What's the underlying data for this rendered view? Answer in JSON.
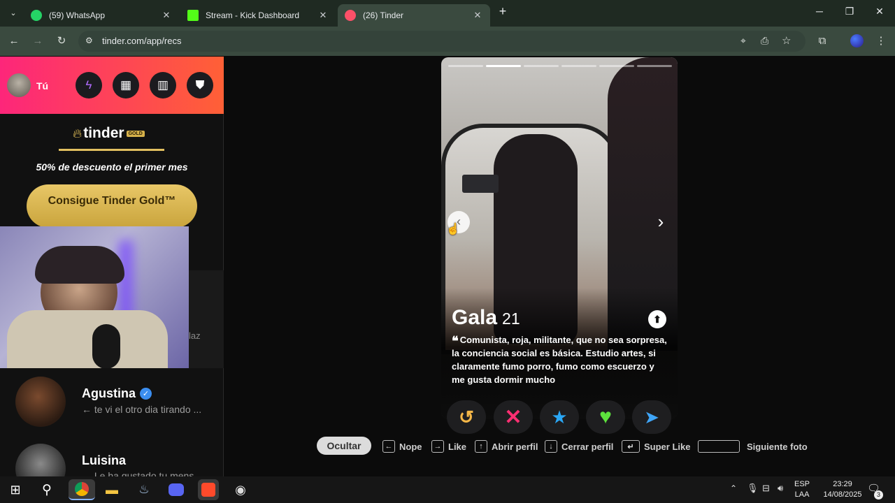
{
  "browser": {
    "tabs": [
      {
        "title": "(59) WhatsApp",
        "icon": "whatsapp-icon",
        "active": false
      },
      {
        "title": "Stream - Kick Dashboard",
        "icon": "kick-icon",
        "active": false
      },
      {
        "title": "(26) Tinder",
        "icon": "tinder-icon",
        "active": true
      }
    ],
    "url": "tinder.com/app/recs"
  },
  "sidebar": {
    "profile_label": "Tú",
    "gold_brand": "tinder",
    "gold_badge": "GOLD",
    "promo_text": "50% de descuento el primer mes",
    "cta_button": "Consigue Tinder Gold™",
    "partial_text": "laz",
    "matches": [
      {
        "name": "Agustina",
        "verified": true,
        "message": "← te vi el otro dia tirando ..."
      },
      {
        "name": "Luisina",
        "verified": false,
        "message": "← Le ha gustado tu mens..."
      }
    ]
  },
  "card": {
    "name": "Gala",
    "age": "21",
    "bio": "Comunista, roja, militante, que no sea sorpresa, la conciencia social es básica. Estudio artes, si claramente fumo porro, fumo como escuerzo y me gusta dormir mucho",
    "photo_count": 6,
    "active_photo": 2
  },
  "actions": [
    {
      "name": "rewind-button",
      "icon": "↺",
      "color": "#f5b748"
    },
    {
      "name": "nope-button",
      "icon": "✕",
      "color": "#fd2f72"
    },
    {
      "name": "super-like-button",
      "icon": "★",
      "color": "#2aa7f5"
    },
    {
      "name": "like-button",
      "icon": "♥",
      "color": "#5de33d"
    },
    {
      "name": "boost-button",
      "icon": "➤",
      "color": "#3fa5f7"
    }
  ],
  "shortcuts": {
    "hide": "Ocultar",
    "nope": "Nope",
    "like": "Like",
    "open_profile": "Abrir perfil",
    "close_profile": "Cerrar perfil",
    "super_like": "Super Like",
    "next_photo": "Siguiente foto"
  },
  "taskbar": {
    "lang_top": "ESP",
    "lang_bottom": "LAA",
    "time": "23:29",
    "date": "14/08/2025",
    "notifications": "3"
  }
}
